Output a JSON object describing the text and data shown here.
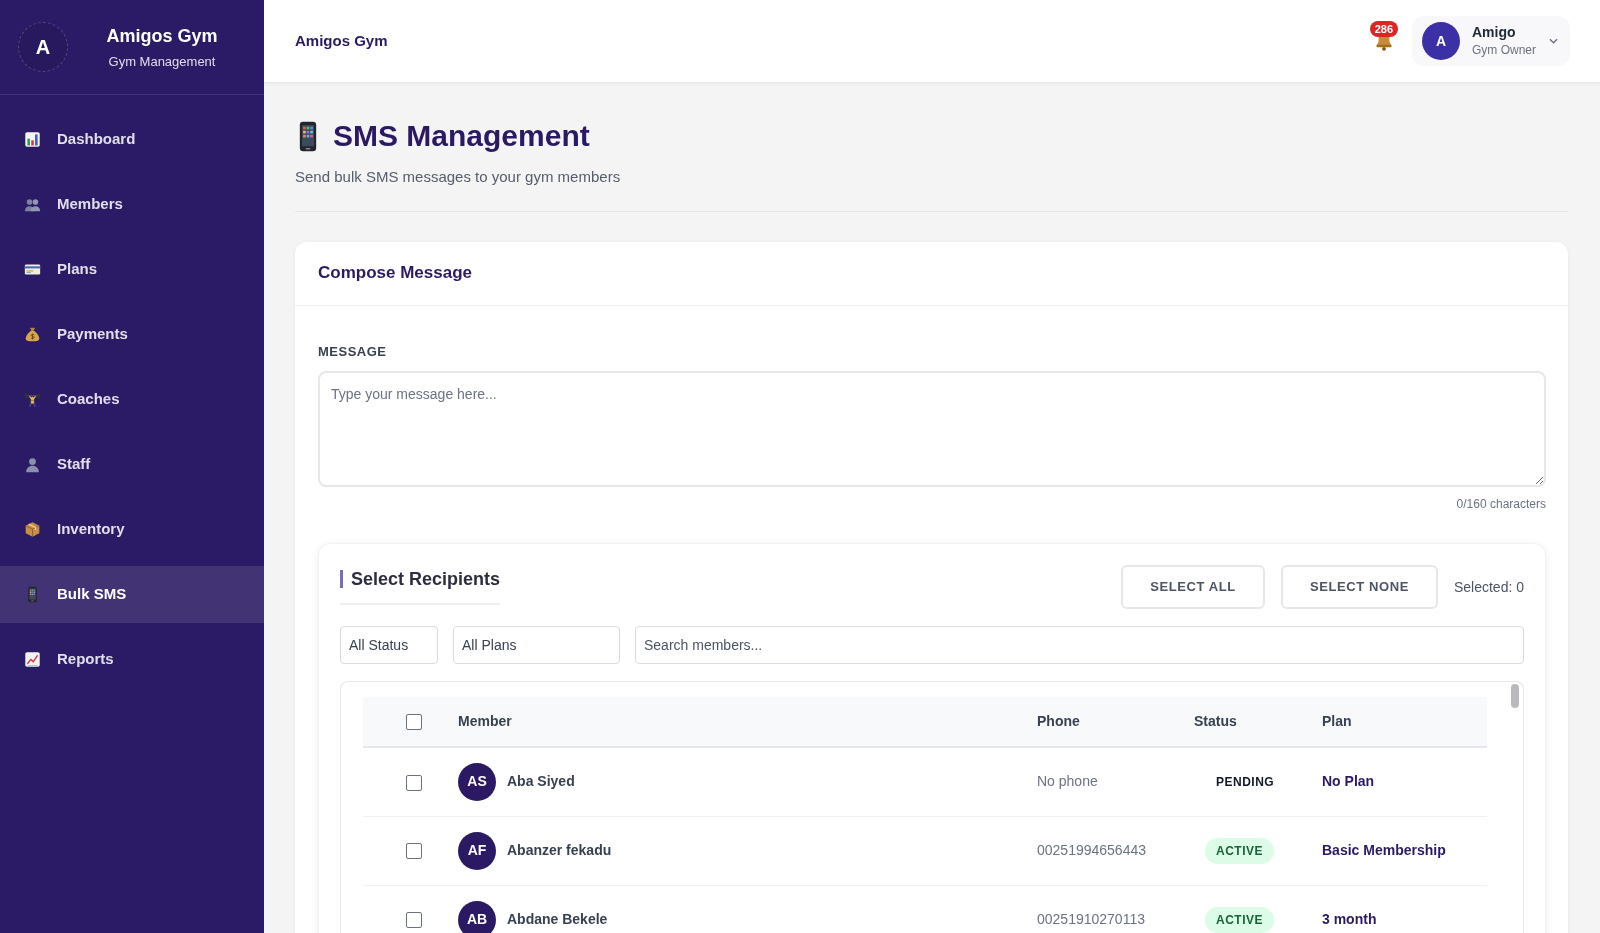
{
  "sidebar": {
    "logo_initial": "A",
    "brand": "Amigos Gym",
    "subtitle": "Gym Management",
    "items": [
      {
        "label": "Dashboard",
        "selected": false
      },
      {
        "label": "Members",
        "selected": false
      },
      {
        "label": "Plans",
        "selected": false
      },
      {
        "label": "Payments",
        "selected": false
      },
      {
        "label": "Coaches",
        "selected": false
      },
      {
        "label": "Staff",
        "selected": false
      },
      {
        "label": "Inventory",
        "selected": false
      },
      {
        "label": "Bulk SMS",
        "selected": true
      },
      {
        "label": "Reports",
        "selected": false
      }
    ]
  },
  "topbar": {
    "title": "Amigos Gym",
    "notifications": "286",
    "user": {
      "initial": "A",
      "name": "Amigo",
      "role": "Gym Owner"
    }
  },
  "page": {
    "title": "SMS Management",
    "subtitle": "Send bulk SMS messages to your gym members"
  },
  "compose": {
    "title": "Compose Message",
    "message_label": "MESSAGE",
    "message": {
      "placeholder": "Type your message here..."
    },
    "counter": "0/160 characters"
  },
  "recipients": {
    "title": "Select Recipients",
    "buttons": [
      "SELECT ALL",
      "SELECT NONE"
    ],
    "selected_count": "Selected: 0",
    "filters": {
      "status": "All Status",
      "plan": "All Plans",
      "search": {
        "placeholder": "Search members..."
      }
    },
    "table": {
      "all_checked": false,
      "columns": [
        "Member",
        "Phone",
        "Status",
        "Plan"
      ],
      "rows": [
        {
          "selected": false,
          "initials": "AS",
          "name": "Aba Siyed",
          "phone": "No phone",
          "status": {
            "text": "PENDING",
            "kind": "pending"
          },
          "plan": "No Plan"
        },
        {
          "selected": false,
          "initials": "AF",
          "name": "Abanzer fekadu",
          "phone": "00251994656443",
          "status": {
            "text": "ACTIVE",
            "kind": "active"
          },
          "plan": "Basic Membership"
        },
        {
          "selected": false,
          "initials": "AB",
          "name": "Abdane Bekele",
          "phone": "00251910270113",
          "status": {
            "text": "ACTIVE",
            "kind": "active"
          },
          "plan": "3 month"
        }
      ]
    }
  }
}
